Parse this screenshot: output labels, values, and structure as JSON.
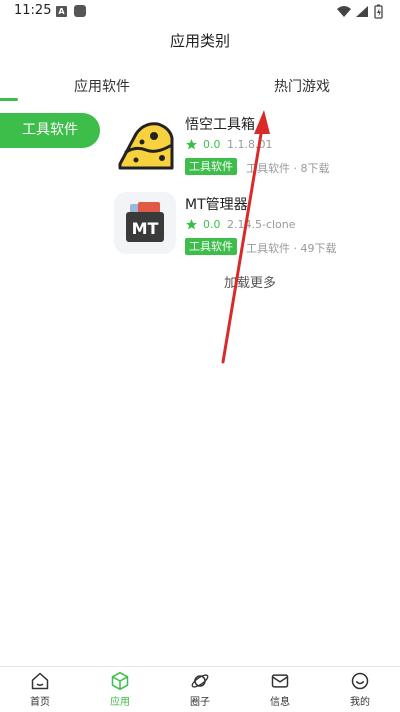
{
  "status_bar": {
    "time": "11:25",
    "notification_letter": "A"
  },
  "header": {
    "title": "应用类别"
  },
  "tabs": [
    {
      "label": "应用软件",
      "active": true
    },
    {
      "label": "热门游戏",
      "active": false
    }
  ],
  "sidebar": {
    "categories": [
      {
        "label": "工具软件",
        "active": true
      }
    ]
  },
  "apps": [
    {
      "name": "悟空工具箱",
      "rating": "0.0",
      "version": "1.1.8.01",
      "tag": "工具软件",
      "meta": "工具软件 · 8下载",
      "icon": "cheese-app-icon"
    },
    {
      "name": "MT管理器",
      "rating": "0.0",
      "version": "2.14.5-clone",
      "tag": "工具软件",
      "meta": "工具软件 · 49下载",
      "icon": "mt-manager-app-icon",
      "icon_text": "MT"
    }
  ],
  "load_more": "加载更多",
  "bottom_nav": [
    {
      "label": "首页",
      "icon": "home-icon",
      "active": false
    },
    {
      "label": "应用",
      "icon": "apps-cube-icon",
      "active": true
    },
    {
      "label": "圈子",
      "icon": "planet-icon",
      "active": false
    },
    {
      "label": "信息",
      "icon": "mail-icon",
      "active": false
    },
    {
      "label": "我的",
      "icon": "profile-icon",
      "active": false
    }
  ],
  "colors": {
    "accent": "#3dbe4a",
    "annotation_arrow": "#d92a2a"
  }
}
